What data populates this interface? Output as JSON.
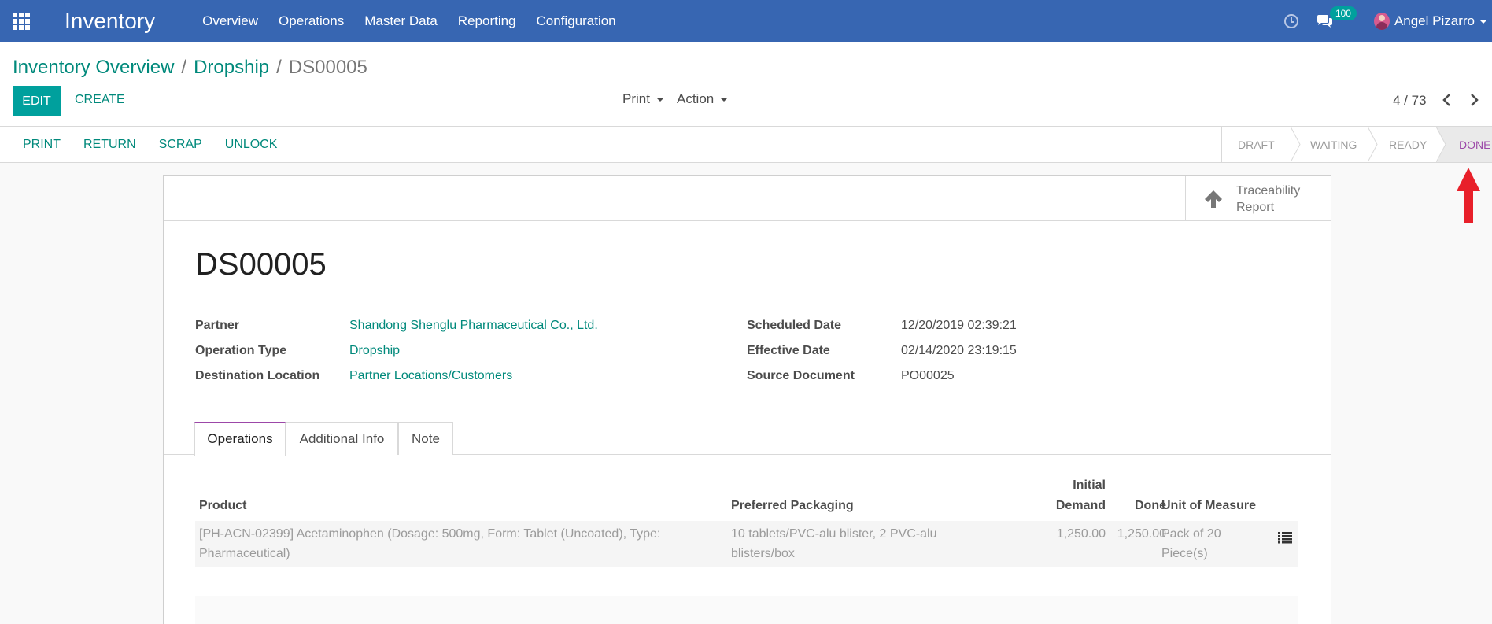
{
  "navbar": {
    "brand": "Inventory",
    "menu": [
      "Overview",
      "Operations",
      "Master Data",
      "Reporting",
      "Configuration"
    ],
    "chat_count": "100",
    "user_name": "Angel Pizarro"
  },
  "control_panel": {
    "breadcrumb": [
      "Inventory Overview",
      "Dropship",
      "DS00005"
    ],
    "edit_label": "EDIT",
    "create_label": "CREATE",
    "print_dropdown": "Print",
    "action_dropdown": "Action",
    "pager": "4 / 73"
  },
  "statusbar": {
    "buttons": [
      "PRINT",
      "RETURN",
      "SCRAP",
      "UNLOCK"
    ],
    "stages": [
      "DRAFT",
      "WAITING",
      "READY",
      "DONE"
    ],
    "active_stage": "DONE"
  },
  "sheet": {
    "smart_button": {
      "line1": "Traceability",
      "line2": "Report"
    },
    "title": "DS00005",
    "fields_left": [
      {
        "label": "Partner",
        "value": "Shandong Shenglu Pharmaceutical Co., Ltd."
      },
      {
        "label": "Operation Type",
        "value": "Dropship"
      },
      {
        "label": "Destination Location",
        "value": "Partner Locations/Customers"
      }
    ],
    "fields_right": [
      {
        "label": "Scheduled Date",
        "value": "12/20/2019 02:39:21"
      },
      {
        "label": "Effective Date",
        "value": "02/14/2020 23:19:15"
      },
      {
        "label": "Source Document",
        "value": "PO00025"
      }
    ],
    "tabs": [
      "Operations",
      "Additional Info",
      "Note"
    ],
    "table": {
      "headers": {
        "product": "Product",
        "packaging": "Preferred Packaging",
        "initial_demand_1": "Initial",
        "initial_demand_2": "Demand",
        "done": "Done",
        "uom": "Unit of Measure"
      },
      "rows": [
        {
          "product_line1": "[PH-ACN-02399] Acetaminophen (Dosage: 500mg, Form: Tablet (Uncoated), Type:",
          "product_line2": "Pharmaceutical)",
          "packaging_line1": "10 tablets/PVC-alu blister, 2 PVC-alu",
          "packaging_line2": "blisters/box",
          "initial_demand": "1,250.00",
          "done": "1,250.00",
          "uom_line1": "Pack of 20",
          "uom_line2": "Piece(s)"
        }
      ]
    }
  },
  "colors": {
    "navbar": "#3766b2",
    "primary": "#00a09d",
    "link": "#00897b",
    "active_stage": "#9c47a8",
    "annotation_arrow": "#e8202a"
  }
}
